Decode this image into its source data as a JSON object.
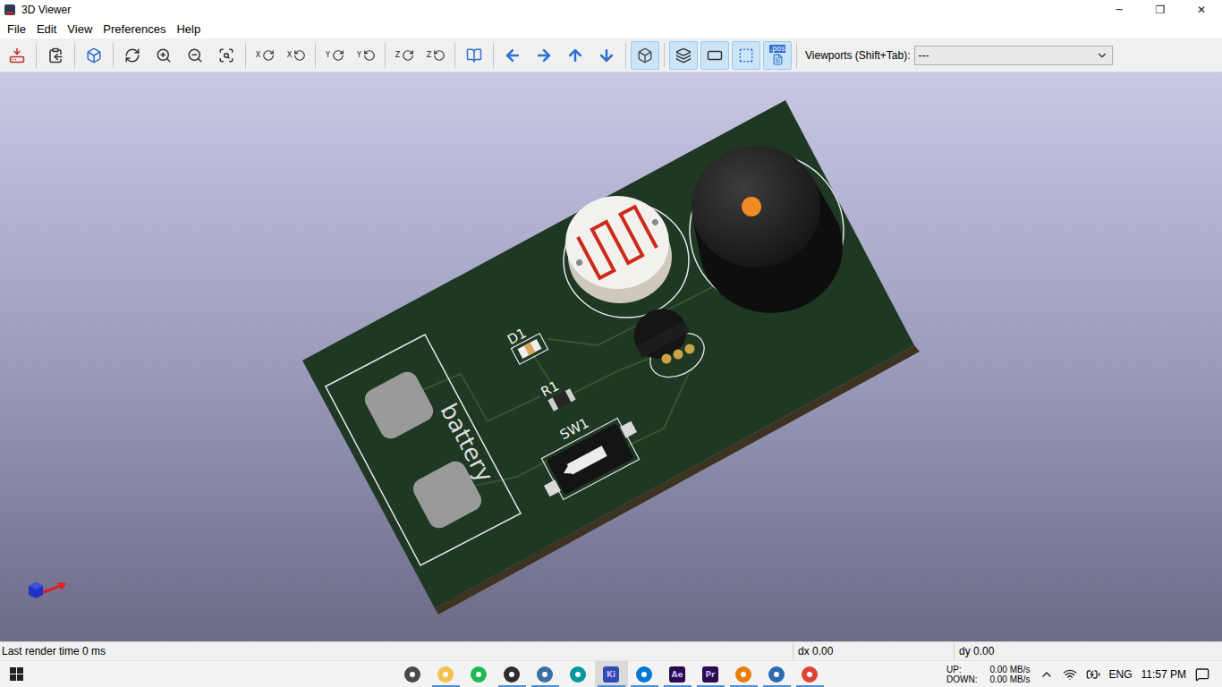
{
  "window": {
    "title": "3D Viewer",
    "controls": [
      "─",
      "❐",
      "✕"
    ]
  },
  "menu": [
    {
      "label": "File"
    },
    {
      "label": "Edit"
    },
    {
      "label": "View"
    },
    {
      "label": "Preferences"
    },
    {
      "label": "Help"
    }
  ],
  "toolbar": {
    "buttons": [
      {
        "selected": false
      },
      {
        "selected": false
      },
      {
        "selected": false
      },
      {
        "selected": false
      },
      {
        "selected": false
      },
      {
        "selected": false
      },
      {
        "selected": false
      },
      {
        "label": "X",
        "selected": false
      },
      {
        "label": "X",
        "selected": false
      },
      {
        "label": "Y",
        "selected": false
      },
      {
        "label": "Y",
        "selected": false
      },
      {
        "label": "Z",
        "selected": false
      },
      {
        "label": "Z",
        "selected": false
      },
      {
        "selected": false
      },
      {
        "selected": false
      },
      {
        "selected": false
      },
      {
        "selected": false
      },
      {
        "selected": false
      },
      {
        "selected": true
      },
      {
        "selected": true
      },
      {
        "selected": true
      },
      {
        "selected": true
      },
      {
        "label": ".pos",
        "selected": true
      }
    ],
    "viewports": {
      "label": "Viewports (Shift+Tab):",
      "value": "---"
    }
  },
  "viewport": {
    "silkscreen": {
      "d1": "D1",
      "r1": "R1",
      "sw1": "SW1",
      "battery": "battery"
    }
  },
  "status_bar": {
    "message": "Last render time 0 ms",
    "dx": "dx 0.00",
    "dy": "dy 0.00"
  },
  "taskbar": {
    "apps": [
      {
        "kind": "icon",
        "color": "#4a4a4a",
        "running": false,
        "selected": false
      },
      {
        "kind": "icon",
        "color": "#f2c14e",
        "running": true,
        "selected": false
      },
      {
        "kind": "icon",
        "color": "#1db954",
        "running": false,
        "selected": false
      },
      {
        "kind": "icon",
        "color": "#2d2d2d",
        "running": true,
        "selected": false
      },
      {
        "kind": "icon",
        "color": "#3a6ea5",
        "running": true,
        "selected": false
      },
      {
        "kind": "icon",
        "color": "#00979d",
        "running": false,
        "selected": false
      },
      {
        "kind": "text",
        "label": "Ki",
        "color": "#314cb0",
        "running": true,
        "selected": true
      },
      {
        "kind": "icon",
        "color": "#0078d4",
        "running": true,
        "selected": false
      },
      {
        "kind": "text",
        "label": "Ae",
        "color": "#2a0b4d",
        "running": true,
        "selected": false
      },
      {
        "kind": "text",
        "label": "Pr",
        "color": "#2a0b4d",
        "running": true,
        "selected": false
      },
      {
        "kind": "icon",
        "color": "#e87d0d",
        "running": true,
        "selected": false
      },
      {
        "kind": "icon",
        "color": "#2b6cb0",
        "running": true,
        "selected": false
      },
      {
        "kind": "icon",
        "color": "#db4437",
        "running": true,
        "selected": false
      }
    ],
    "network": {
      "up_label": "UP:",
      "up": "0.00 MB/s",
      "down_label": "DOWN:",
      "down": "0.00 MB/s"
    },
    "language": "ENG",
    "time": "11:57 PM"
  }
}
